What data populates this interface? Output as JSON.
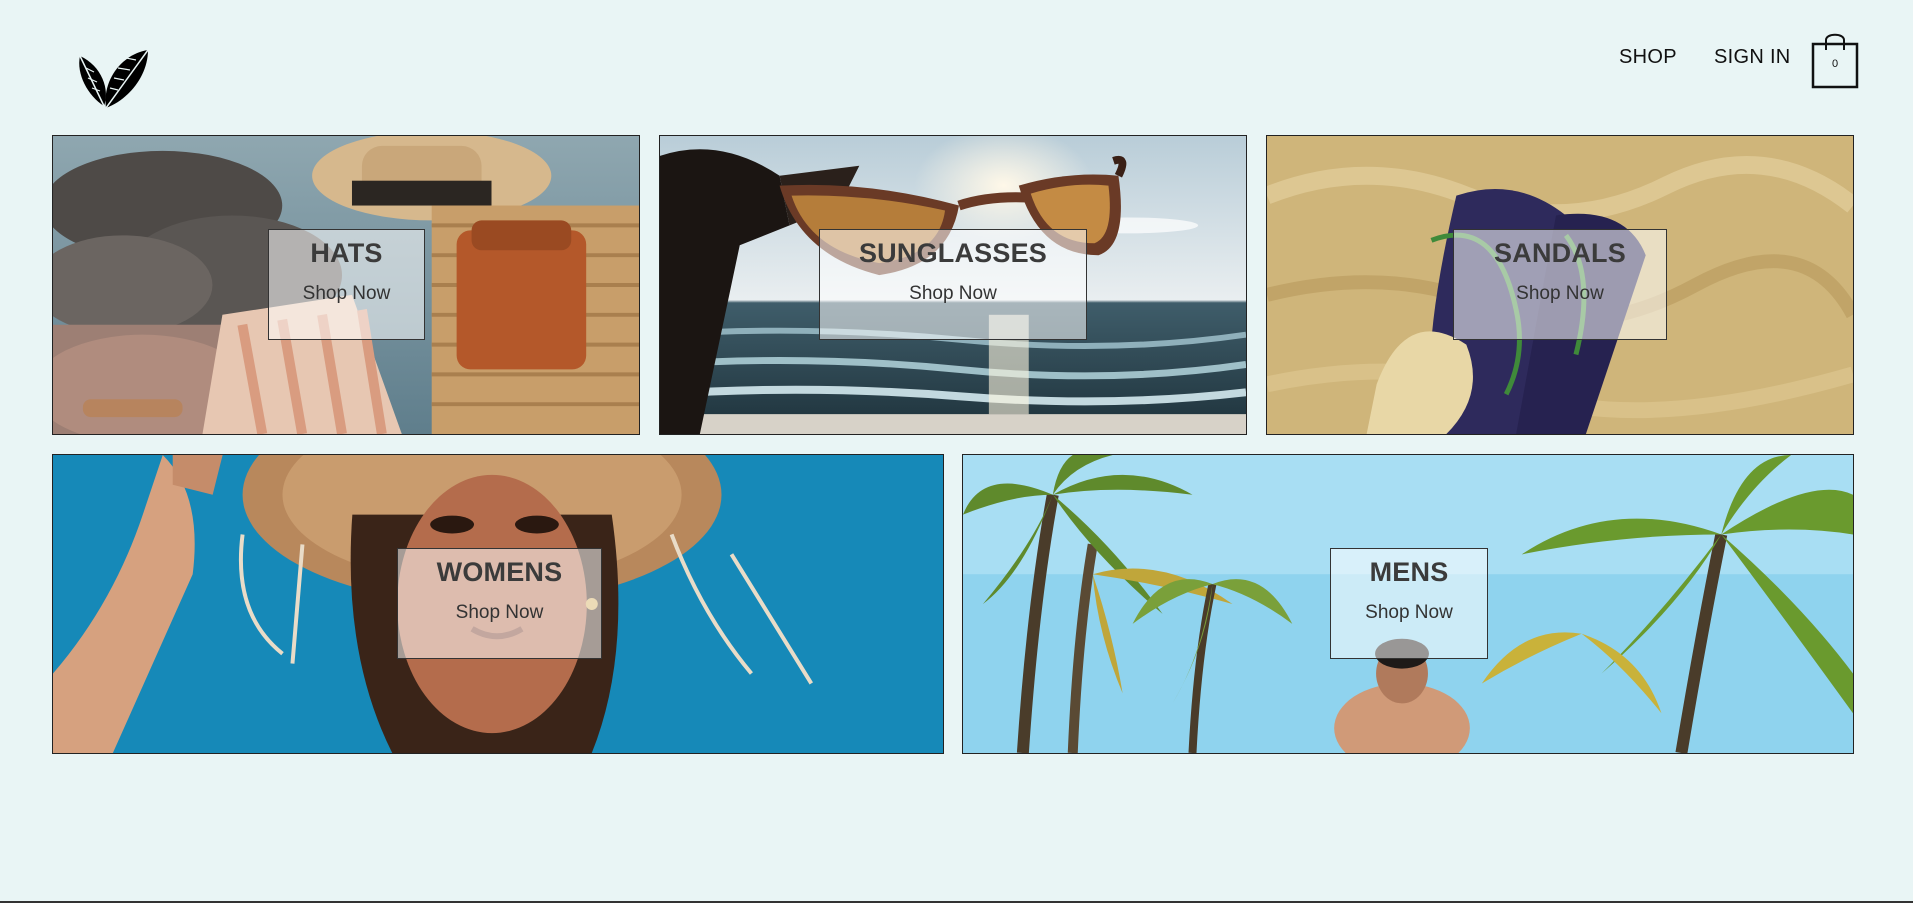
{
  "header": {
    "logo_icon": "leaf-logo-icon",
    "nav": {
      "shop_label": "SHOP",
      "signin_label": "SIGN IN"
    },
    "cart": {
      "icon": "shopping-bag-icon",
      "count": "0"
    }
  },
  "categories": [
    {
      "title": "HATS",
      "cta": "Shop Now"
    },
    {
      "title": "SUNGLASSES",
      "cta": "Shop Now"
    },
    {
      "title": "SANDALS",
      "cta": "Shop Now"
    },
    {
      "title": "WOMENS",
      "cta": "Shop Now"
    },
    {
      "title": "MENS",
      "cta": "Shop Now"
    }
  ],
  "colors": {
    "page_background": "#e9f5f5",
    "text": "#111111",
    "label_background": "rgba(255,255,255,0.55)"
  }
}
